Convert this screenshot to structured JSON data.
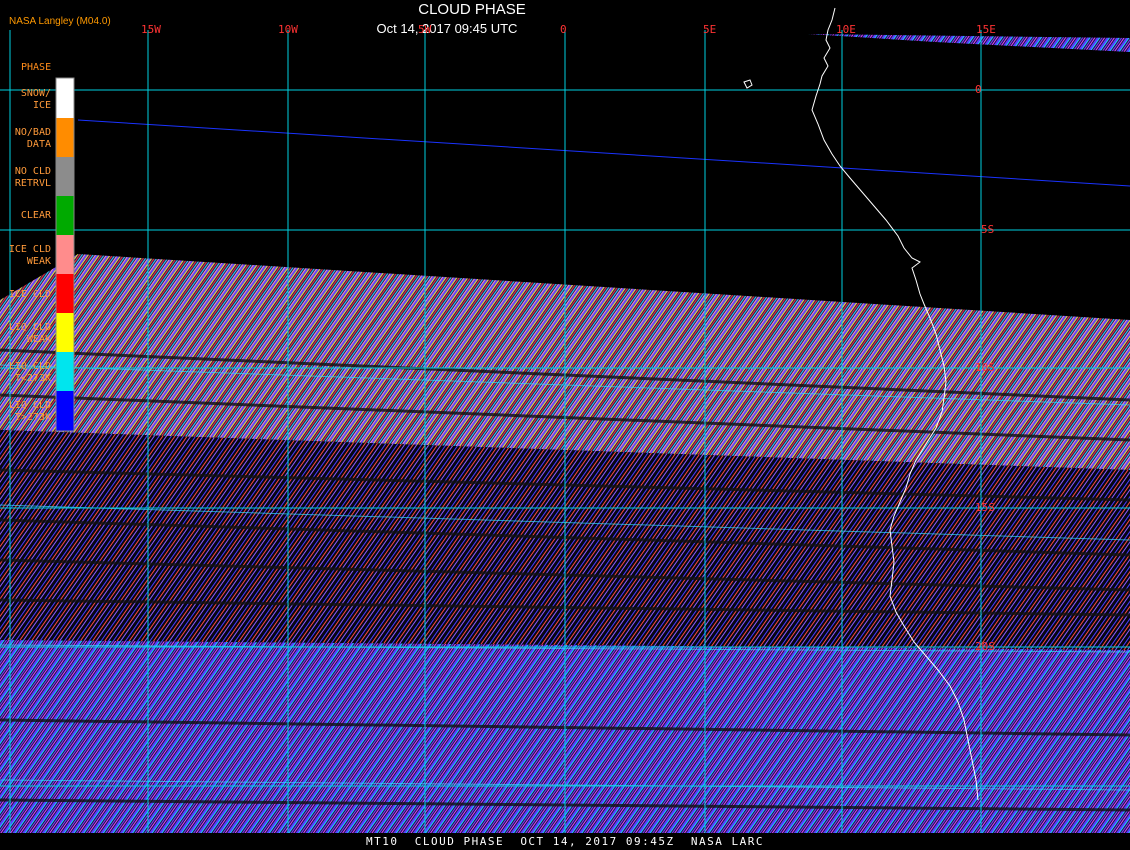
{
  "header": {
    "title": "CLOUD PHASE",
    "subtitle": "Oct 14, 2017 09:45 UTC",
    "credit": "NASA Langley (M04.0)"
  },
  "legend": {
    "title": "PHASE",
    "items": [
      {
        "label": "SNOW/\nICE",
        "color": "#ffffff"
      },
      {
        "label": "NO/BAD\nDATA",
        "color": "#ff8c00"
      },
      {
        "label": "NO CLD\nRETRVL",
        "color": "#8c8c8c"
      },
      {
        "label": "CLEAR",
        "color": "#00aa00"
      },
      {
        "label": "ICE CLD\nWEAK",
        "color": "#ff8c8c"
      },
      {
        "label": "ICE CLD",
        "color": "#ff0000"
      },
      {
        "label": "LIQ CLD\nWEAK",
        "color": "#ffff00"
      },
      {
        "label": "LIQ CLD\nT<273K",
        "color": "#00e5ee"
      },
      {
        "label": "LIQ CLD\nT>273K",
        "color": "#0000ff"
      }
    ]
  },
  "grid": {
    "lon_labels": [
      "15W",
      "10W",
      "5W",
      "0",
      "5E",
      "10E",
      "15E"
    ],
    "lat_labels": [
      "0",
      "5S",
      "10S",
      "15S",
      "20S"
    ]
  },
  "colors": {
    "grid": "#00d0e0",
    "coast": "#ffffff",
    "orbit_line": "#1a33ff",
    "grid_label": "#ff3333"
  },
  "footer": {
    "text": "MT10  CLOUD PHASE  OCT 14, 2017 09:45Z  NASA LARC"
  }
}
